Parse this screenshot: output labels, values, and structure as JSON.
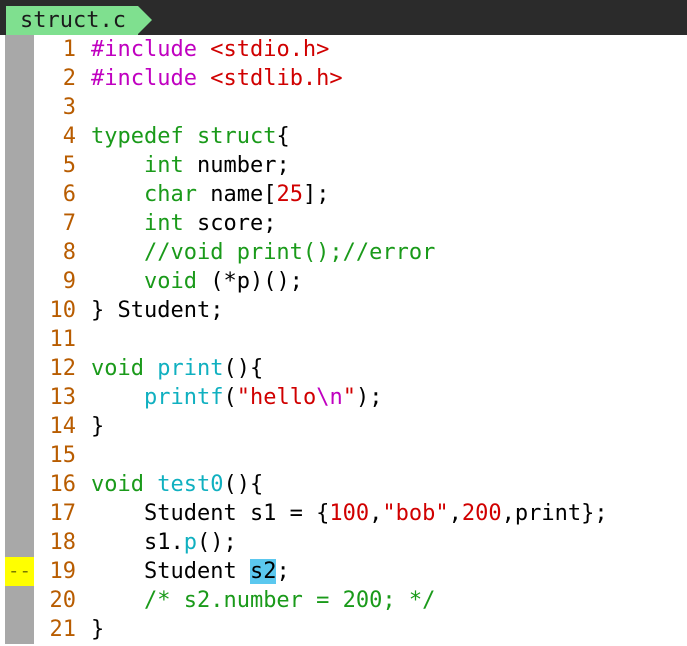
{
  "tab": {
    "filename": "struct.c"
  },
  "signs": {
    "active_line_marker": "--"
  },
  "lines": [
    {
      "n": "1",
      "tokens": [
        {
          "t": "#include ",
          "c": "pre"
        },
        {
          "t": "<stdio.h>",
          "c": "str"
        }
      ]
    },
    {
      "n": "2",
      "tokens": [
        {
          "t": "#include ",
          "c": "pre"
        },
        {
          "t": "<stdlib.h>",
          "c": "str"
        }
      ]
    },
    {
      "n": "3",
      "tokens": []
    },
    {
      "n": "4",
      "tokens": [
        {
          "t": "typedef",
          "c": "kw"
        },
        {
          "t": " ",
          "c": "pl"
        },
        {
          "t": "struct",
          "c": "kw"
        },
        {
          "t": "{",
          "c": "pl"
        }
      ]
    },
    {
      "n": "5",
      "tokens": [
        {
          "t": "    ",
          "c": "pl"
        },
        {
          "t": "int",
          "c": "kw"
        },
        {
          "t": " number;",
          "c": "pl"
        }
      ]
    },
    {
      "n": "6",
      "tokens": [
        {
          "t": "    ",
          "c": "pl"
        },
        {
          "t": "char",
          "c": "kw"
        },
        {
          "t": " name[",
          "c": "pl"
        },
        {
          "t": "25",
          "c": "num"
        },
        {
          "t": "];",
          "c": "pl"
        }
      ]
    },
    {
      "n": "7",
      "tokens": [
        {
          "t": "    ",
          "c": "pl"
        },
        {
          "t": "int",
          "c": "kw"
        },
        {
          "t": " score;",
          "c": "pl"
        }
      ]
    },
    {
      "n": "8",
      "tokens": [
        {
          "t": "    ",
          "c": "pl"
        },
        {
          "t": "//void print();//error",
          "c": "cmt"
        }
      ]
    },
    {
      "n": "9",
      "tokens": [
        {
          "t": "    ",
          "c": "pl"
        },
        {
          "t": "void",
          "c": "kw"
        },
        {
          "t": " (*p)();",
          "c": "pl"
        }
      ]
    },
    {
      "n": "10",
      "tokens": [
        {
          "t": "} Student;",
          "c": "pl"
        }
      ]
    },
    {
      "n": "11",
      "tokens": []
    },
    {
      "n": "12",
      "tokens": [
        {
          "t": "void",
          "c": "kw"
        },
        {
          "t": " ",
          "c": "pl"
        },
        {
          "t": "print",
          "c": "fn"
        },
        {
          "t": "(){",
          "c": "pl"
        }
      ]
    },
    {
      "n": "13",
      "tokens": [
        {
          "t": "    ",
          "c": "pl"
        },
        {
          "t": "printf",
          "c": "fn"
        },
        {
          "t": "(",
          "c": "pl"
        },
        {
          "t": "\"hello",
          "c": "str"
        },
        {
          "t": "\\n",
          "c": "esc"
        },
        {
          "t": "\"",
          "c": "str"
        },
        {
          "t": ");",
          "c": "pl"
        }
      ]
    },
    {
      "n": "14",
      "tokens": [
        {
          "t": "}",
          "c": "pl"
        }
      ]
    },
    {
      "n": "15",
      "tokens": []
    },
    {
      "n": "16",
      "tokens": [
        {
          "t": "void",
          "c": "kw"
        },
        {
          "t": " ",
          "c": "pl"
        },
        {
          "t": "test0",
          "c": "fn"
        },
        {
          "t": "(){",
          "c": "pl"
        }
      ]
    },
    {
      "n": "17",
      "tokens": [
        {
          "t": "    Student s1 = {",
          "c": "pl"
        },
        {
          "t": "100",
          "c": "num"
        },
        {
          "t": ",",
          "c": "pl"
        },
        {
          "t": "\"bob\"",
          "c": "str"
        },
        {
          "t": ",",
          "c": "pl"
        },
        {
          "t": "200",
          "c": "num"
        },
        {
          "t": ",print};",
          "c": "pl"
        }
      ]
    },
    {
      "n": "18",
      "tokens": [
        {
          "t": "    s1.",
          "c": "pl"
        },
        {
          "t": "p",
          "c": "fn"
        },
        {
          "t": "();",
          "c": "pl"
        }
      ]
    },
    {
      "n": "19",
      "sign": true,
      "tokens": [
        {
          "t": "    Student ",
          "c": "pl"
        },
        {
          "t": "s2",
          "c": "hl"
        },
        {
          "t": ";",
          "c": "pl"
        }
      ]
    },
    {
      "n": "20",
      "tokens": [
        {
          "t": "    ",
          "c": "pl"
        },
        {
          "t": "/* s2.number = 200; */",
          "c": "cmt"
        }
      ]
    },
    {
      "n": "21",
      "tokens": [
        {
          "t": "}",
          "c": "pl"
        }
      ]
    }
  ],
  "colors": {
    "preprocessor": "#c000c0",
    "keyword": "#1a9a1a",
    "function": "#10b0c0",
    "string": "#d00000",
    "number": "#d00000",
    "comment": "#1a9a1a",
    "line_number": "#b85c00",
    "tab_active": "#7fe08f",
    "tabline_bg": "#2b2b2b",
    "search_highlight": "#5bc8ef",
    "sign_column": "#a8a8a8",
    "sign_active": "#ffff00"
  }
}
